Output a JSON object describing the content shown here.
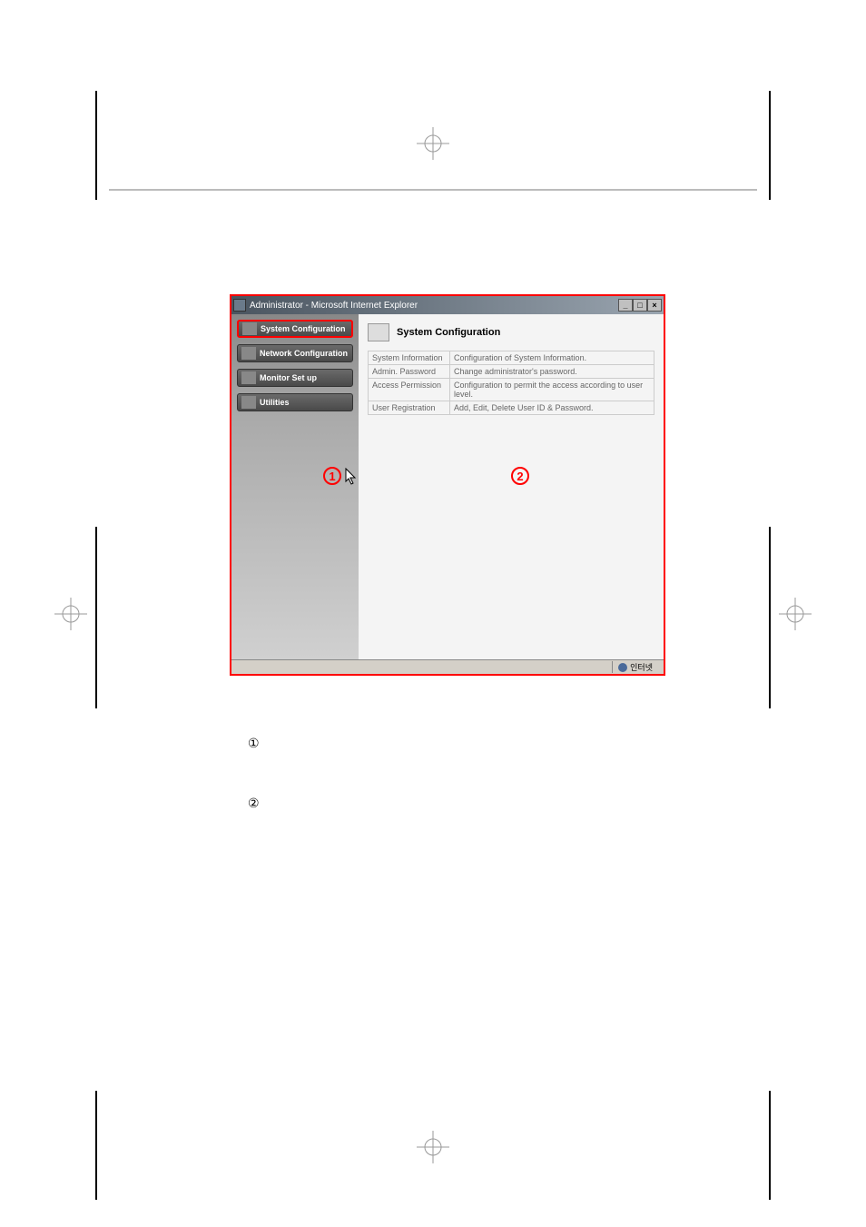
{
  "window": {
    "title": "Administrator - Microsoft Internet Explorer"
  },
  "sidebar": {
    "items": [
      {
        "label": "System Configuration"
      },
      {
        "label": "Network Configuration"
      },
      {
        "label": "Monitor Set up"
      },
      {
        "label": "Utilities"
      }
    ]
  },
  "content": {
    "title": "System Configuration",
    "rows": [
      {
        "label": "System Information",
        "desc": "Configuration of System Information."
      },
      {
        "label": "Admin. Password",
        "desc": "Change administrator's password."
      },
      {
        "label": "Access Permission",
        "desc": "Configuration to permit the access according to user level."
      },
      {
        "label": "User Registration",
        "desc": "Add, Edit, Delete User ID & Password."
      }
    ]
  },
  "statusbar": {
    "text": "인터넷"
  },
  "annotations": {
    "one": "1",
    "two": "2"
  },
  "below": {
    "num1": "①",
    "num2": "②"
  }
}
